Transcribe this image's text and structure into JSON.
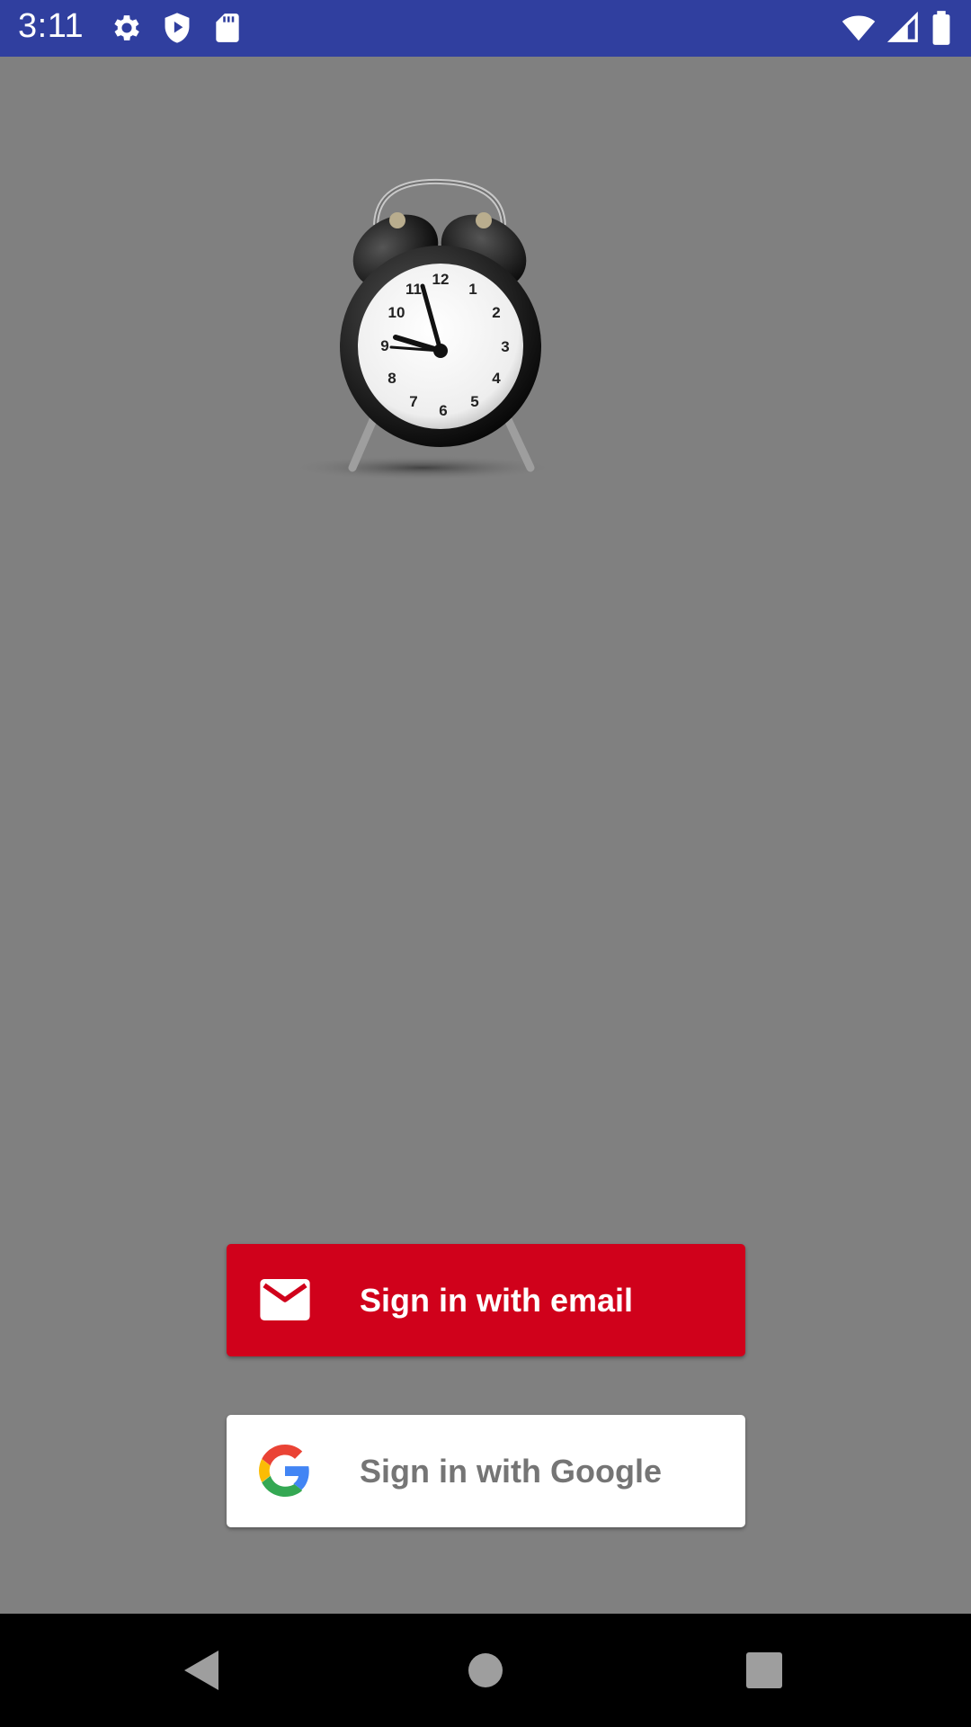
{
  "status_bar": {
    "time": "3:11",
    "left_icons": [
      "settings-gear-icon",
      "play-protect-icon",
      "sd-card-icon"
    ],
    "right_icons": [
      "wifi-icon",
      "signal-icon",
      "battery-icon"
    ],
    "background_color": "#303F9F"
  },
  "hero": {
    "image": "alarm-clock-image",
    "clock_face_numbers": [
      "12",
      "1",
      "2",
      "3",
      "4",
      "5",
      "6",
      "7",
      "8",
      "9",
      "10",
      "11"
    ]
  },
  "auth": {
    "email_button_label": "Sign in with email",
    "email_button_color": "#D0011B",
    "email_icon": "mail-icon",
    "google_button_label": "Sign in with Google",
    "google_button_color": "#FFFFFF",
    "google_icon": "google-g-icon"
  },
  "nav_bar": {
    "buttons": [
      "back-icon",
      "home-icon",
      "recents-icon"
    ]
  },
  "colors": {
    "background": "#808080"
  }
}
